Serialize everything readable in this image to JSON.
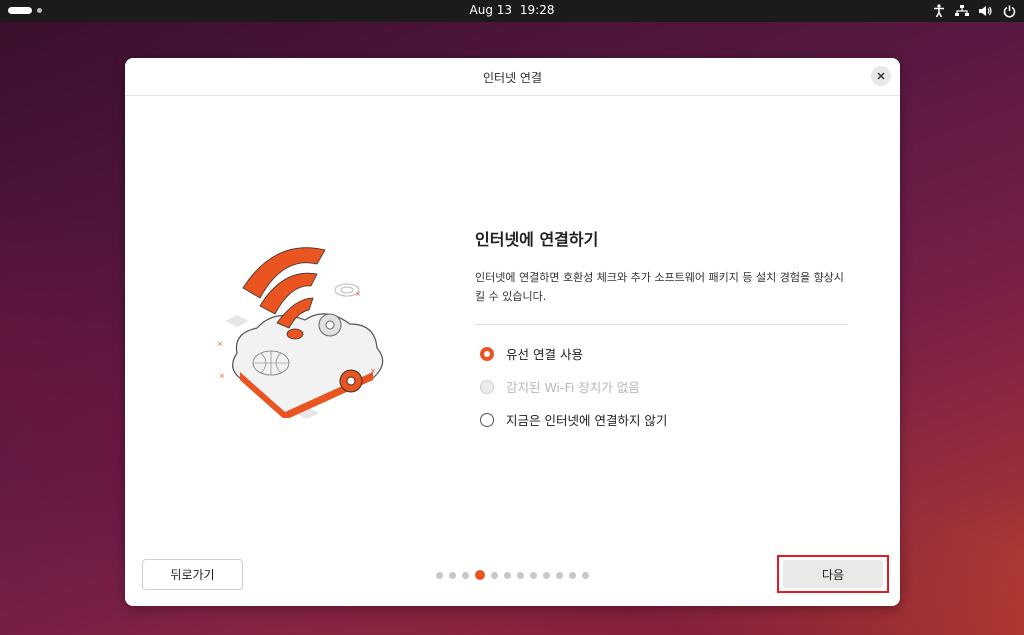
{
  "topbar": {
    "date": "Aug 13",
    "time": "19:28",
    "icons": [
      "accessibility-icon",
      "network-icon",
      "volume-icon",
      "power-icon"
    ]
  },
  "dialog": {
    "title": "인터넷 연결",
    "heading": "인터넷에 연결하기",
    "description": "인터넷에 연결하면 호환성 체크와 추가 소프트웨어 패키지 등 설치 경험을 향상시킬 수 있습니다.",
    "options": [
      {
        "label": "유선 연결 사용",
        "state": "checked"
      },
      {
        "label": "감지된 Wi-Fi 장치가 없음",
        "state": "disabled"
      },
      {
        "label": "지금은 인터넷에 연결하지 않기",
        "state": "unchecked"
      }
    ],
    "back_label": "뒤로가기",
    "next_label": "다음",
    "progress": {
      "total": 12,
      "current": 4
    }
  },
  "colors": {
    "accent": "#e95420",
    "highlight": "#e21c24"
  }
}
